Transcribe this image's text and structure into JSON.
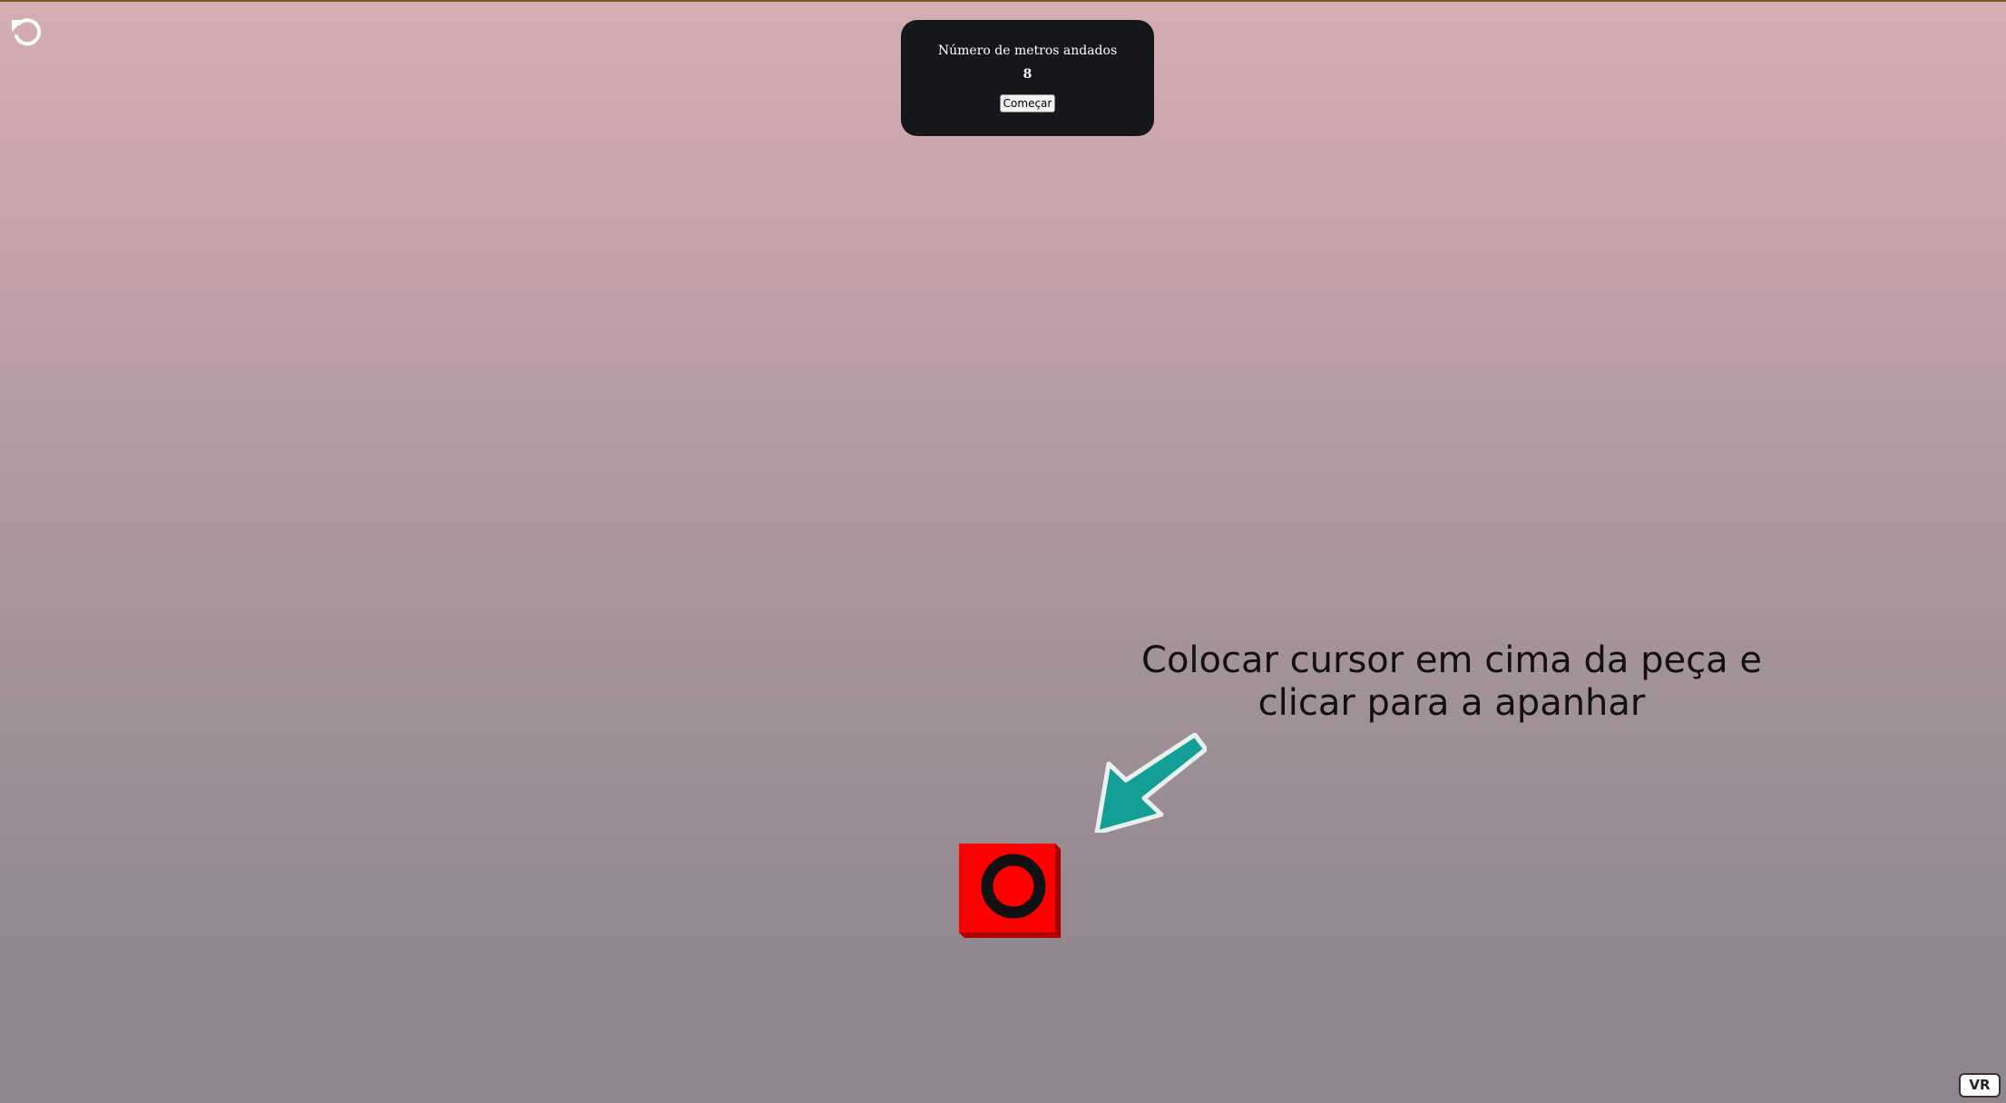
{
  "hud": {
    "title": "Número de metros andados",
    "meters": "8",
    "start_button": "Começar"
  },
  "instruction": {
    "line1": "Colocar cursor em cima da peça e",
    "line2": "clicar para a apanhar"
  },
  "vr_button": "VR",
  "icons": {
    "reset": "undo-icon",
    "arrow": "arrow-pointer-icon",
    "piece": "red-cube-piece-icon"
  },
  "colors": {
    "hud_bg": "#16171b",
    "arrow": "#139e96",
    "piece": "#ff0000",
    "piece_ring": "#111111"
  }
}
